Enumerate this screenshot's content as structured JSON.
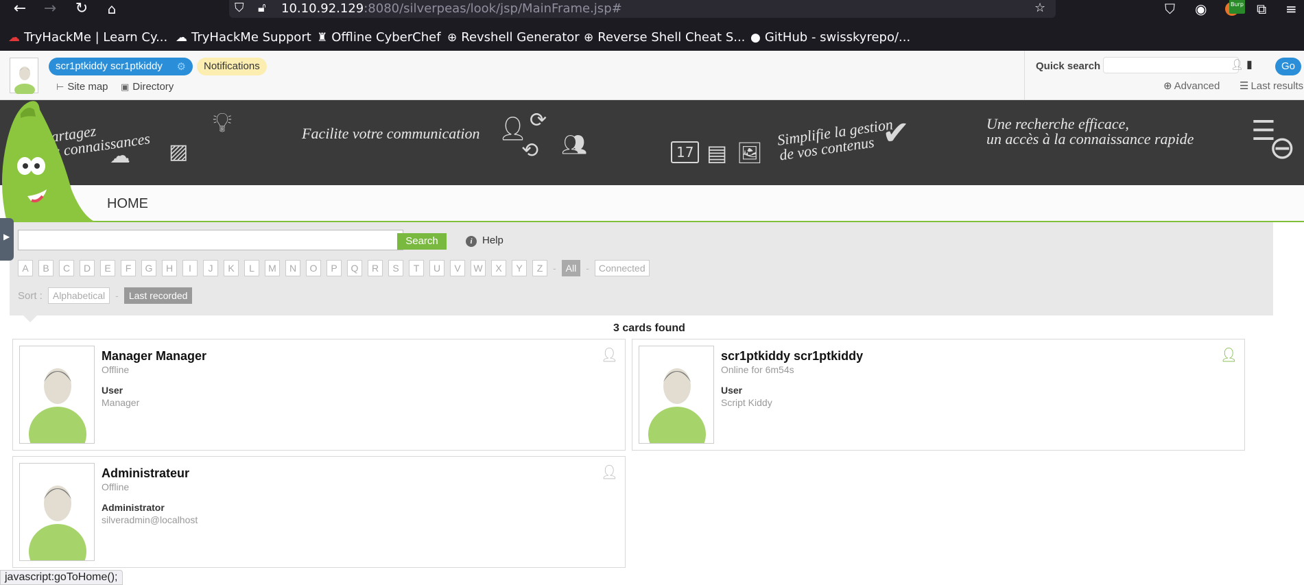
{
  "browser": {
    "url_host": "10.10.92.129",
    "url_rest": ":8080/silverpeas/look/jsp/MainFrame.jsp#",
    "toolbar_badge": "Burp",
    "bookmarks": [
      {
        "label": "TryHackMe | Learn Cy...",
        "icon": "tryhackme-icon"
      },
      {
        "label": "TryHackMe Support",
        "icon": "tryhackme-support-icon"
      },
      {
        "label": "Offline CyberChef",
        "icon": "cyberchef-icon"
      },
      {
        "label": "Revshell Generator",
        "icon": "globe-icon"
      },
      {
        "label": "Reverse Shell Cheat S...",
        "icon": "globe-icon"
      },
      {
        "label": "GitHub - swisskyrepo/...",
        "icon": "github-icon"
      }
    ]
  },
  "topbar": {
    "user_name": "scr1ptkiddy scr1ptkiddy",
    "notifications": "Notifications",
    "site_map": "Site map",
    "directory": "Directory",
    "quick_search_label": "Quick search",
    "go": "Go",
    "advanced": "Advanced",
    "last_results": "Last results"
  },
  "banner": {
    "slogan1": [
      "Partagez",
      "vos connaissances"
    ],
    "slogan2": "Facilite votre communication",
    "slogan3": [
      "Simplifie la gestion",
      "de vos contenus"
    ],
    "slogan4": [
      "Une recherche efficace,",
      "un accès à la connaissance rapide"
    ],
    "calendar_day": "17"
  },
  "home_tab": "HOME",
  "search": {
    "button": "Search",
    "help": "Help",
    "letters": [
      "A",
      "B",
      "C",
      "D",
      "E",
      "F",
      "G",
      "H",
      "I",
      "J",
      "K",
      "L",
      "M",
      "N",
      "O",
      "P",
      "Q",
      "R",
      "S",
      "T",
      "U",
      "V",
      "W",
      "X",
      "Y",
      "Z"
    ],
    "all": "All",
    "connected": "Connected",
    "sort_label": "Sort :",
    "sort_options": [
      "Alphabetical",
      "Last recorded"
    ],
    "active_sort": "Last recorded"
  },
  "results": {
    "count": "3 cards found",
    "cards": [
      {
        "name": "Manager Manager",
        "status": "Offline",
        "role": "User",
        "detail": "Manager",
        "online": false
      },
      {
        "name": "scr1ptkiddy scr1ptkiddy",
        "status": "Online for 6m54s",
        "role": "User",
        "detail": "Script Kiddy",
        "online": true
      },
      {
        "name": "Administrateur",
        "status": "Offline",
        "role": "Administrator",
        "detail": "silveradmin@localhost",
        "online": false
      }
    ]
  },
  "status_bar": "javascript:goToHome();",
  "colors": {
    "accent_blue": "#2a8ed8",
    "accent_green": "#7ab940",
    "banner_bg": "#3a3a3a"
  }
}
